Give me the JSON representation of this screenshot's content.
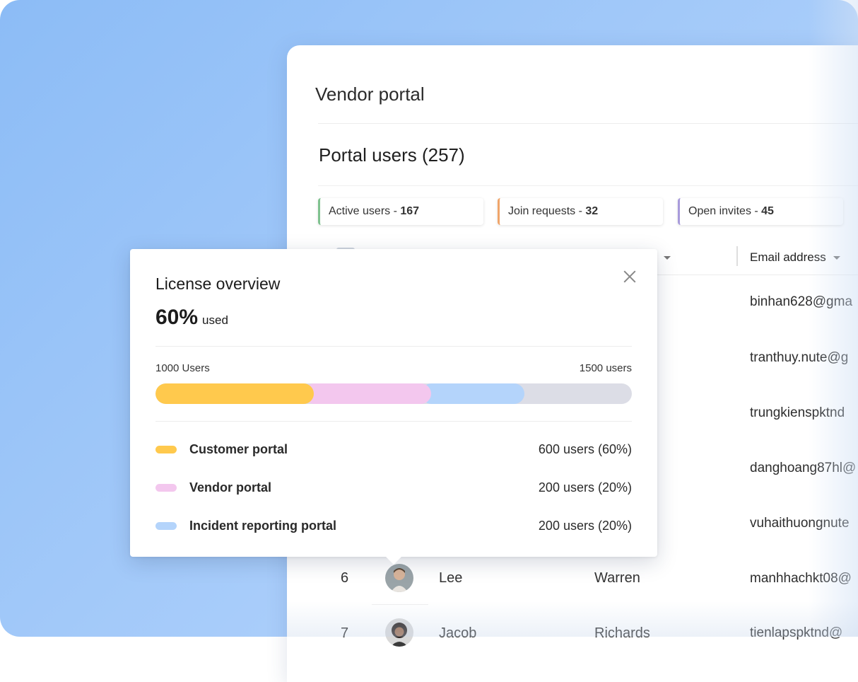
{
  "colors": {
    "customer": "#ffc94d",
    "vendor": "#f3c7ee",
    "incident": "#b4d4fb",
    "track": "#dcdde6"
  },
  "portal": {
    "title": "Vendor portal",
    "users_heading": "Portal users (257)",
    "stats": [
      {
        "label": "Active users - ",
        "value": "167"
      },
      {
        "label": "Join requests - ",
        "value": "32"
      },
      {
        "label": "Open invites - ",
        "value": "45"
      }
    ],
    "table": {
      "email_header": "Email address",
      "emails": [
        "binhan628@gma",
        "tranthuy.nute@g",
        "trungkienspktnd",
        "danghoang87hl@",
        "vuhaithuongnute",
        "manhhachkt08@",
        "tienlapspktnd@"
      ],
      "rows": [
        {
          "index": "6",
          "first": "Lee",
          "last": "Warren"
        },
        {
          "index": "7",
          "first": "Jacob",
          "last": "Richards"
        }
      ]
    }
  },
  "license": {
    "title": "License overview",
    "percent": "60%",
    "percent_label": "used",
    "left_label": "1000 Users",
    "right_label": "1500 users",
    "segments": [
      {
        "fraction_start": 0.0,
        "fraction_end": 0.333
      },
      {
        "fraction_start": 0.333,
        "fraction_end": 0.578
      },
      {
        "fraction_start": 0.578,
        "fraction_end": 0.775
      }
    ],
    "legend": [
      {
        "name": "Customer portal",
        "value": "600 users (60%)"
      },
      {
        "name": "Vendor portal",
        "value": "200 users (20%)"
      },
      {
        "name": "Incident reporting portal",
        "value": "200 users (20%)"
      }
    ]
  }
}
